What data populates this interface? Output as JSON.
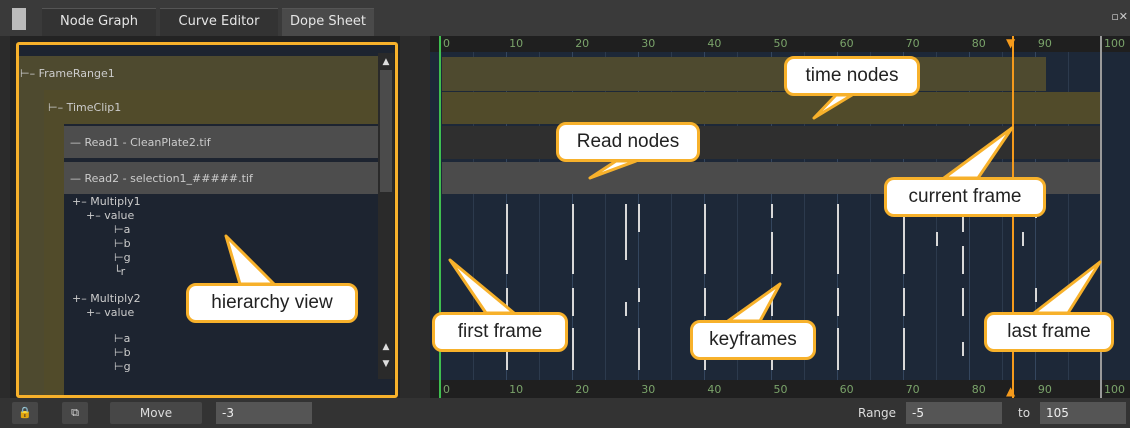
{
  "tabs": [
    {
      "label": "Node Graph"
    },
    {
      "label": "Curve Editor"
    },
    {
      "label": "Dope Sheet"
    }
  ],
  "hierarchy": {
    "frame_range": "FrameRange1",
    "time_clip": "TimeClip1",
    "read1": "Read1 - CleanPlate2.tif",
    "read2": "Read2 - selection1_#####.tif",
    "multiply1": "Multiply1",
    "value1": "value",
    "channels1": [
      "a",
      "b",
      "g",
      "r"
    ],
    "multiply2": "Multiply2",
    "value2": "value",
    "channels2": [
      "a",
      "b",
      "g"
    ]
  },
  "ruler_labels": [
    "0",
    "10",
    "20",
    "30",
    "40",
    "50",
    "60",
    "70",
    "80",
    "90",
    "100"
  ],
  "frames": {
    "first": 0,
    "current": 85,
    "last": 100
  },
  "toolbar": {
    "lock_icon": "lock-icon",
    "copy_icon": "copy-icon",
    "move_label": "Move",
    "move_value": "-3",
    "range_label": "Range",
    "range_start": "-5",
    "to_label": "to",
    "range_end": "105"
  },
  "callouts": {
    "time_nodes": "time nodes",
    "read_nodes": "Read nodes",
    "current_frame": "current frame",
    "hierarchy_view": "hierarchy view",
    "first_frame": "first frame",
    "keyframes": "keyframes",
    "last_frame": "last frame"
  },
  "colors": {
    "accent": "#f7b12b",
    "current_frame": "#f49a1c",
    "first_frame": "#3fbf4f"
  }
}
